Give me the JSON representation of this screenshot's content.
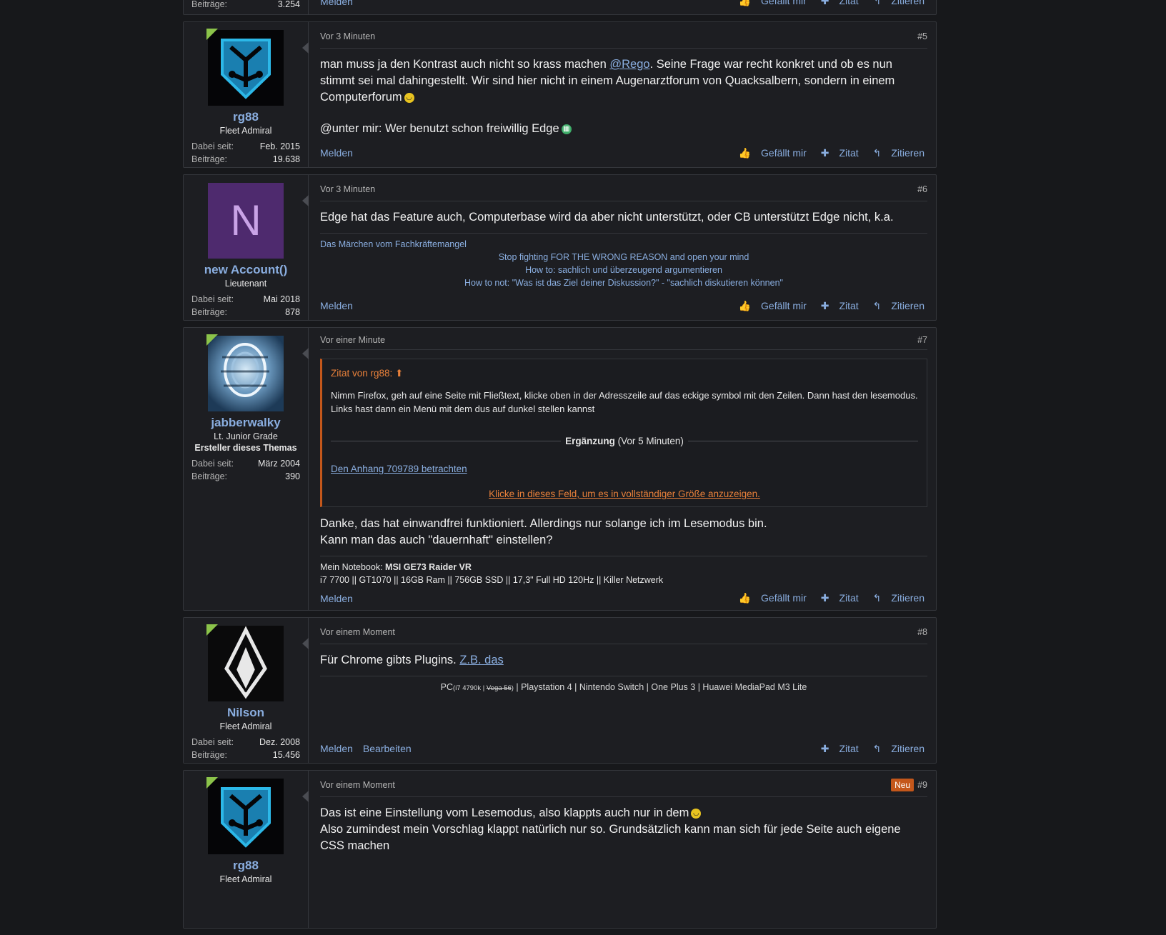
{
  "previous_post": {
    "stat_label": "Beiträge:",
    "stat_value": "3.254",
    "report": "Melden",
    "like": "Gefällt mir",
    "quote": "Zitat",
    "reply": "Zitieren"
  },
  "labels": {
    "since": "Dabei seit:",
    "posts": "Beiträge:",
    "report": "Melden",
    "edit": "Bearbeiten",
    "like": "Gefällt mir",
    "quote": "Zitat",
    "reply": "Zitieren"
  },
  "posts": [
    {
      "time": "Vor 3 Minuten",
      "number": "#5",
      "username": "rg88",
      "title": "Fleet Admiral",
      "since": "Feb. 2015",
      "count": "19.638",
      "text_a": "man muss ja den Kontrast auch nicht so krass machen ",
      "mention": "@Rego",
      "text_b": ". Seine Frage war recht konkret und ob es nun stimmt sei mal dahingestellt. Wir sind hier nicht in einem Augenarztforum von Quacksalbern, sondern in einem Computerforum",
      "text_c": "@unter mir: Wer benutzt schon freiwillig Edge"
    },
    {
      "time": "Vor 3 Minuten",
      "number": "#6",
      "username": "new Account()",
      "title": "Lieutenant",
      "avatar_letter": "N",
      "since": "Mai 2018",
      "count": "878",
      "text": "Edge hat das Feature auch, Computerbase wird da aber nicht unterstützt, oder CB unterstützt Edge nicht, k.a.",
      "sig_1": "Das Märchen vom Fachkräftemangel",
      "sig_2": "Stop fighting FOR THE WRONG REASON and open your mind",
      "sig_3": "How to: sachlich und überzeugend argumentieren",
      "sig_4": "How to not: \"Was ist das Ziel deiner Diskussion?\" - \"sachlich diskutieren können\""
    },
    {
      "time": "Vor einer Minute",
      "number": "#7",
      "username": "jabberwalky",
      "title": "Lt. Junior Grade",
      "starter": "Ersteller dieses Themas",
      "since": "März 2004",
      "count": "390",
      "quote_header": "Zitat von rg88:",
      "quote_text": "Nimm Firefox, geh auf eine Seite mit Fließtext, klicke oben in der Adresszeile auf das eckige symbol mit den Zeilen. Dann hast den lesemodus. Links hast dann ein Menü mit dem dus auf dunkel stellen kannst",
      "addition_bold": "Ergänzung",
      "addition_time": "(Vor 5 Minuten)",
      "attachment": "Den Anhang 709789 betrachten",
      "expand": "Klicke in dieses Feld, um es in vollständiger Größe anzuzeigen.",
      "text_1": "Danke, das hat einwandfrei funktioniert. Allerdings nur solange ich im Lesemodus bin.",
      "text_2": "Kann man das auch \"dauernhaft\" einstellen?",
      "sig_label": "Mein Notebook: ",
      "sig_bold": "MSI GE73 Raider VR",
      "sig_line": "i7 7700 || GT1070 || 16GB Ram || 756GB SSD || 17,3\" Full HD 120Hz || Killer Netzwerk"
    },
    {
      "time": "Vor einem Moment",
      "number": "#8",
      "username": "Nilson",
      "title": "Fleet Admiral",
      "since": "Dez. 2008",
      "count": "15.456",
      "text": "Für Chrome gibts Plugins. ",
      "link": "Z.B. das",
      "sig_pc": "PC",
      "sig_small_a": "(i7 4790k | ",
      "sig_small_strike": "Vega 56",
      "sig_small_b": ")",
      "sig_rest": " | Playstation 4 | Nintendo Switch | One Plus 3 | Huawei MediaPad M3 Lite"
    },
    {
      "time": "Vor einem Moment",
      "number": "#9",
      "badge": "Neu",
      "username": "rg88",
      "title": "Fleet Admiral",
      "text_1": "Das ist eine Einstellung vom Lesemodus, also klappts auch nur in dem",
      "text_2": "Also zumindest mein Vorschlag klappt natürlich nur so. Grundsätzlich kann man sich für jede Seite auch eigene CSS machen"
    }
  ],
  "colors": {
    "background": "#17181b",
    "panel": "#1d1e22",
    "link": "#8aaee0",
    "quote_accent": "#c4571b",
    "online": "#8bc34a",
    "avatar_purple": "#4e2a6e"
  }
}
